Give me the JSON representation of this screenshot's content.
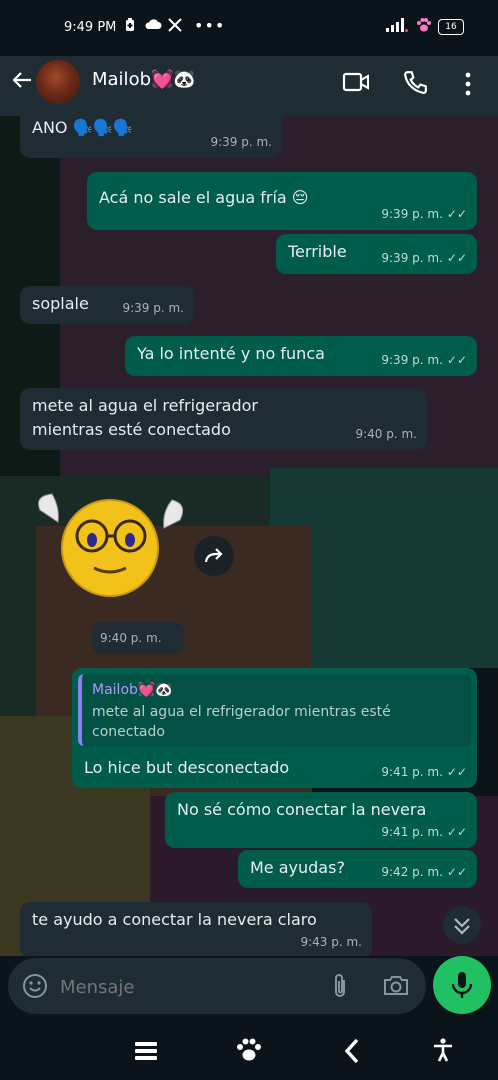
{
  "status_bar": {
    "time": "9:49 PM",
    "icons": [
      "battery-saver-icon",
      "cloud-icon",
      "x-logo-icon",
      "more-dots-icon"
    ],
    "right_icons": [
      "signal-icon",
      "paw-icon",
      "battery-icon"
    ],
    "battery_level": "16"
  },
  "header": {
    "contact_name": "Mailob💓🐼",
    "icons": [
      "back-arrow-icon",
      "video-call-icon",
      "phone-icon",
      "more-vertical-icon"
    ]
  },
  "messages": [
    {
      "dir": "in",
      "text": "ANO 🗣️🗣️🗣️",
      "time": "9:39 p. m."
    },
    {
      "dir": "out",
      "text": "Acá no sale el agua fría 😔",
      "time": "9:39 p. m."
    },
    {
      "dir": "out",
      "text": "Terrible",
      "time": "9:39 p. m."
    },
    {
      "dir": "in",
      "text": "soplale",
      "time": "9:39 p. m."
    },
    {
      "dir": "out",
      "text": "Ya lo intenté y no funca",
      "time": "9:39 p. m."
    },
    {
      "dir": "in",
      "text": "mete al agua el refrigerador mientras esté conectado",
      "time": "9:40 p. m."
    },
    {
      "dir": "in",
      "kind": "sticker",
      "time": "9:40 p. m."
    },
    {
      "dir": "out",
      "quote_name": "Mailob💓🐼",
      "quote_text": "mete al agua el refrigerador mientras esté conectado",
      "text": "Lo hice but desconectado",
      "time": "9:41 p. m."
    },
    {
      "dir": "out",
      "text": "No sé cómo conectar la nevera",
      "time": "9:41 p. m."
    },
    {
      "dir": "out",
      "text": "Me ayudas?",
      "time": "9:42 p. m."
    },
    {
      "dir": "in",
      "text": "te ayudo a conectar la nevera claro",
      "time": "9:43 p. m."
    }
  ],
  "composer": {
    "placeholder": "Mensaje",
    "icons": [
      "emoji-icon",
      "attach-icon",
      "camera-icon",
      "mic-icon"
    ]
  },
  "nav_bar": {
    "icons": [
      "recent-apps-icon",
      "paw-home-icon",
      "back-icon",
      "accessibility-icon"
    ]
  },
  "colors": {
    "incoming_bubble": "#1f2c33",
    "outgoing_bubble": "#005c4b",
    "accent_green": "#21c063",
    "quote_bar": "#8f7cf7"
  }
}
